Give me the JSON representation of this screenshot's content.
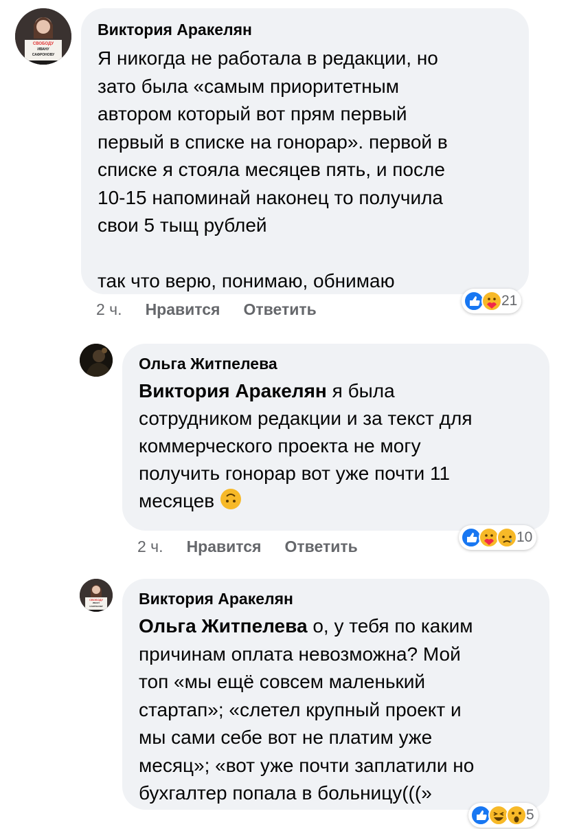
{
  "comments": [
    {
      "author": "Виктория Аракелян",
      "mention": "",
      "text": "Я никогда не работала в редакции, но\nзато была «самым приоритетным\nавтором который вот прям первый\nпервый в списке на гонорар». первой в\nсписке я стояла месяцев пять, и после\n10-15 напоминай наконец то получила\nсвои 5 тыщ рублей\n\nтак что верю, понимаю, обнимаю",
      "time": "2 ч.",
      "like": "Нравится",
      "reply": "Ответить",
      "reaction_count": "21",
      "reactions": [
        "like-icon",
        "care-icon"
      ],
      "avatar_sign": [
        "СВОБОДУ",
        "ИВАНУ",
        "САФРОНОВУ"
      ]
    },
    {
      "author": "Ольга Житпелева",
      "mention": "Виктория Аракелян",
      "text": " я была\nсотрудником редакции и за текст для\nкоммерческого проекта не могу\nполучить гонорар вот уже почти 11\nмесяцев",
      "time": "2 ч.",
      "like": "Нравится",
      "reply": "Ответить",
      "reaction_count": "10",
      "reactions": [
        "like-icon",
        "care-icon",
        "sad-icon"
      ]
    },
    {
      "author": "Виктория Аракелян",
      "mention": "Ольга Житпелева",
      "text": " о, у тебя по каким\nпричинам оплата невозможна? Мой\nтоп «мы ещё совсем маленький\nстартап»; «слетел крупный проект и\nмы сами себе вот не платим уже\nмесяц»; «вот уже почти заплатили но\nбухгалтер попала в больницу(((»",
      "reaction_count": "5",
      "reactions": [
        "like-icon",
        "haha-icon",
        "wow-icon"
      ],
      "avatar_sign": [
        "СВОБОДУ",
        "ИВАНУ",
        "САФРОНОВУ"
      ]
    }
  ],
  "colors": {
    "bubble": "#f0f2f5",
    "meta": "#65676b",
    "like_blue": "#1877f2",
    "emoji_yellow": "#f7b928"
  }
}
